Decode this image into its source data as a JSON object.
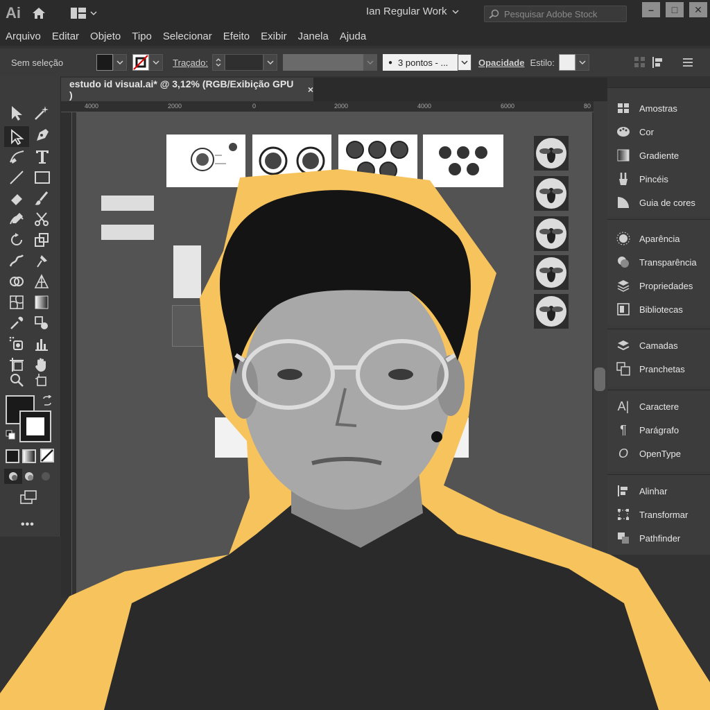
{
  "titlebar": {
    "app_logo": "Ai",
    "workspace": "Ian Regular Work",
    "search_placeholder": "Pesquisar Adobe Stock"
  },
  "menu": [
    "Arquivo",
    "Editar",
    "Objeto",
    "Tipo",
    "Selecionar",
    "Efeito",
    "Exibir",
    "Janela",
    "Ajuda"
  ],
  "control": {
    "selection": "Sem seleção",
    "stroke_label": "Traçado:",
    "brush": "3 pontos - ...",
    "opacity_label": "Opacidade",
    "style_label": "Estilo:"
  },
  "document_tab": {
    "title": "estudo id visual.ai* @ 3,12% (RGB/Exibição GPU )",
    "close": "×"
  },
  "rulers": {
    "top": [
      "4000",
      "2000",
      "0",
      "2000",
      "4000",
      "6000",
      "80"
    ]
  },
  "right_panel": {
    "groups": [
      [
        "Amostras",
        "Cor",
        "Gradiente",
        "Pincéis",
        "Guia de cores"
      ],
      [
        "Aparência",
        "Transparência",
        "Propriedades",
        "Bibliotecas"
      ],
      [
        "Camadas",
        "Pranchetas"
      ],
      [
        "Caractere",
        "Parágrafo",
        "OpenType"
      ],
      [
        "Alinhar",
        "Transformar",
        "Pathfinder"
      ]
    ]
  },
  "colors": {
    "accent_yellow": "#f7c35c",
    "ui_dark": "#2b2b2b",
    "panel": "#3a3a3a",
    "canvas": "#535353"
  }
}
